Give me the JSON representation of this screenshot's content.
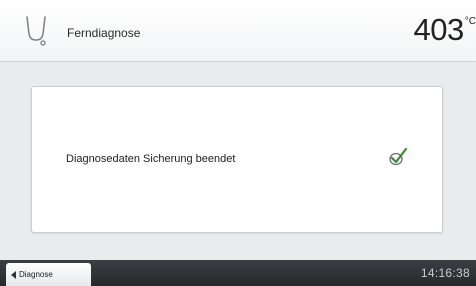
{
  "header": {
    "icon": "stethoscope-icon",
    "title": "Ferndiagnose",
    "temperature": "403",
    "temperature_unit": "°C"
  },
  "panel": {
    "message": "Diagnosedaten Sicherung beendet",
    "status_icon": "check-icon",
    "status_color": "#3a8a2e"
  },
  "footer": {
    "back_label": "Diagnose",
    "time": "14:16:38"
  }
}
